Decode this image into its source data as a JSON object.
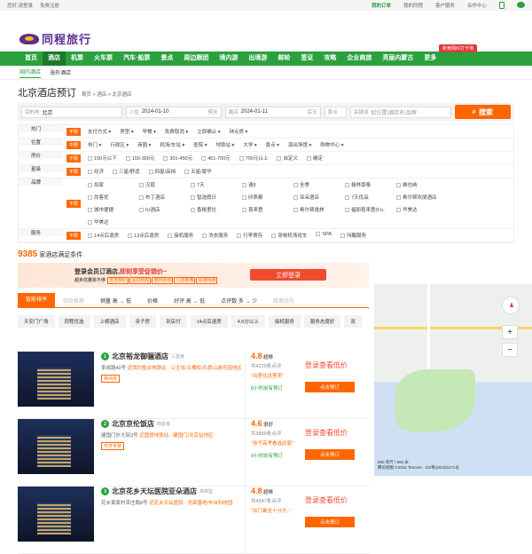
{
  "topbar": {
    "hello": "您好,请登录",
    "register": "免费注册",
    "orders": "我的订单",
    "mytc": "我的同程",
    "service": "客户服务",
    "partner": "合作中心"
  },
  "brand": {
    "name": "同程旅行",
    "promo": "新黄网红打卡地"
  },
  "nav": [
    "首页",
    "酒店",
    "机票",
    "火车票",
    "汽车·船票",
    "景点",
    "周边跟团",
    "境内游",
    "出境游",
    "邮轮",
    "签证",
    "攻略",
    "企业商旅",
    "亮丽内蒙古",
    "更多"
  ],
  "subnav": [
    "国内酒店",
    "海外酒店"
  ],
  "page": {
    "title": "北京酒店预订",
    "breadcrumb": "首页 > 酒店 > 北京酒店"
  },
  "search": {
    "dest_label": "目的地",
    "dest": "北京",
    "in_label": "入住",
    "checkin": "2024-01-10",
    "checkin_day": "明天",
    "out_label": "离店",
    "checkout": "2024-01-11",
    "checkout_day": "后天",
    "poi_label": "景点",
    "kw_label": "关键词",
    "kw_placeholder": "如位置\\酒店名\\品牌",
    "btn": "搜索"
  },
  "filters": [
    {
      "label": "热门",
      "items": [
        "支付方式",
        "房型",
        "早餐",
        "免费取消",
        "立即确认",
        "钟点房"
      ]
    },
    {
      "label": "位置",
      "items": [
        "热门",
        "行政区",
        "商圈",
        "机场/车站",
        "医院",
        "地铁站",
        "大学",
        "景点",
        "演出场馆",
        "购物中心"
      ]
    },
    {
      "label": "房价",
      "items": [
        "150元以下",
        "150-300元",
        "301-450元",
        "451-700元",
        "700元以上",
        "自定义",
        "确定"
      ]
    },
    {
      "label": "星级",
      "items": [
        "经济",
        "三星/舒适",
        "四星/高档",
        "五星/豪华"
      ]
    },
    {
      "label": "品牌",
      "items": [
        "如家",
        "汉庭",
        "7天",
        "速8",
        "全季",
        "格林豪泰",
        "维也纳",
        "尚客优",
        "布丁酒店",
        "智选假日",
        "欣燕都",
        "亚朵酒店",
        "7天优品",
        "希尔顿欢朋酒店",
        "城市便捷",
        "IU酒店",
        "香格里拉",
        "喜来登",
        "希尔顿逸林",
        "福朋喜来登(Fo..",
        "华美达",
        "华美达"
      ]
    },
    {
      "label": "服务",
      "items": [
        "14点后退房",
        "13点后退房",
        "接机服务",
        "洗衣服务",
        "行李寄存",
        "穿梭机场班车",
        "SPA",
        "叫醒服务"
      ]
    }
  ],
  "nolimit": "不限",
  "results": {
    "count": "9385",
    "suffix": "家酒店满足条件"
  },
  "member": {
    "line1a": "登录会员订酒店,",
    "line1b": "即刻享受促销价~",
    "line2": "超多优惠享不停",
    "tags": [
      "天天特价",
      "会员特权",
      "限时抢购",
      "门店新春",
      "出游特惠"
    ],
    "btn": "立即登录"
  },
  "sort": [
    "智能排序",
    "综合推荐",
    "销量 高 → 低",
    "价格",
    "好评 高 → 低",
    "点评数 多 → 少",
    "距离优先"
  ],
  "tags": [
    "天安门广场",
    "同程优选",
    "上榜酒店",
    "亲子房",
    "到店付",
    "14点后退房",
    "4.5分以上",
    "接机服务",
    "服务态度好",
    "双"
  ],
  "hotels": [
    {
      "no": "1",
      "name": "北京裕龙御骊酒店",
      "star": "三星级",
      "addr": "阜成路40号",
      "near": "近西钓鱼台地铁站 · 公主坟/五棵松/石景山游乐园地区",
      "badge": "钟点房",
      "score": "4.8",
      "level": "超棒",
      "reviews": "共4229条点评",
      "comment": "\"出差住这里来\"",
      "time": "8小时前有预订",
      "login_price": "登录查看低价",
      "btn": "点击预订"
    },
    {
      "no": "2",
      "name": "北京京伦饭店",
      "star": "四星级",
      "addr": "建国门外大街3号",
      "near": "近国贸地铁站 · 建国门/北京站地区",
      "badge": "可开专票",
      "score": "4.6",
      "level": "很好",
      "reviews": "共3889条点评",
      "comment": "\"孩子高考看选此家\"",
      "time": "9小时前有预订",
      "login_price": "登录查看低价",
      "btn": "点击预订"
    },
    {
      "no": "3",
      "name": "北京花乡天坛医院亚朵酒店",
      "star": "高档型",
      "addr": "花乡黄家村幸庄路8号",
      "near": "近花乡天坛医院 · 总部基地/丰台科技园",
      "badge": "",
      "score": "4.8",
      "level": "超棒",
      "reviews": "共4347条点评",
      "comment": "\"出门乘坐十分方..\"",
      "time": "",
      "login_price": "登录查看低价",
      "btn": "点击预订"
    }
  ],
  "map": {
    "copyright": "腾讯地图 ©2024 Tencent - GS粤(2023)1171号",
    "scale": "500 英尺 / 500 米"
  }
}
